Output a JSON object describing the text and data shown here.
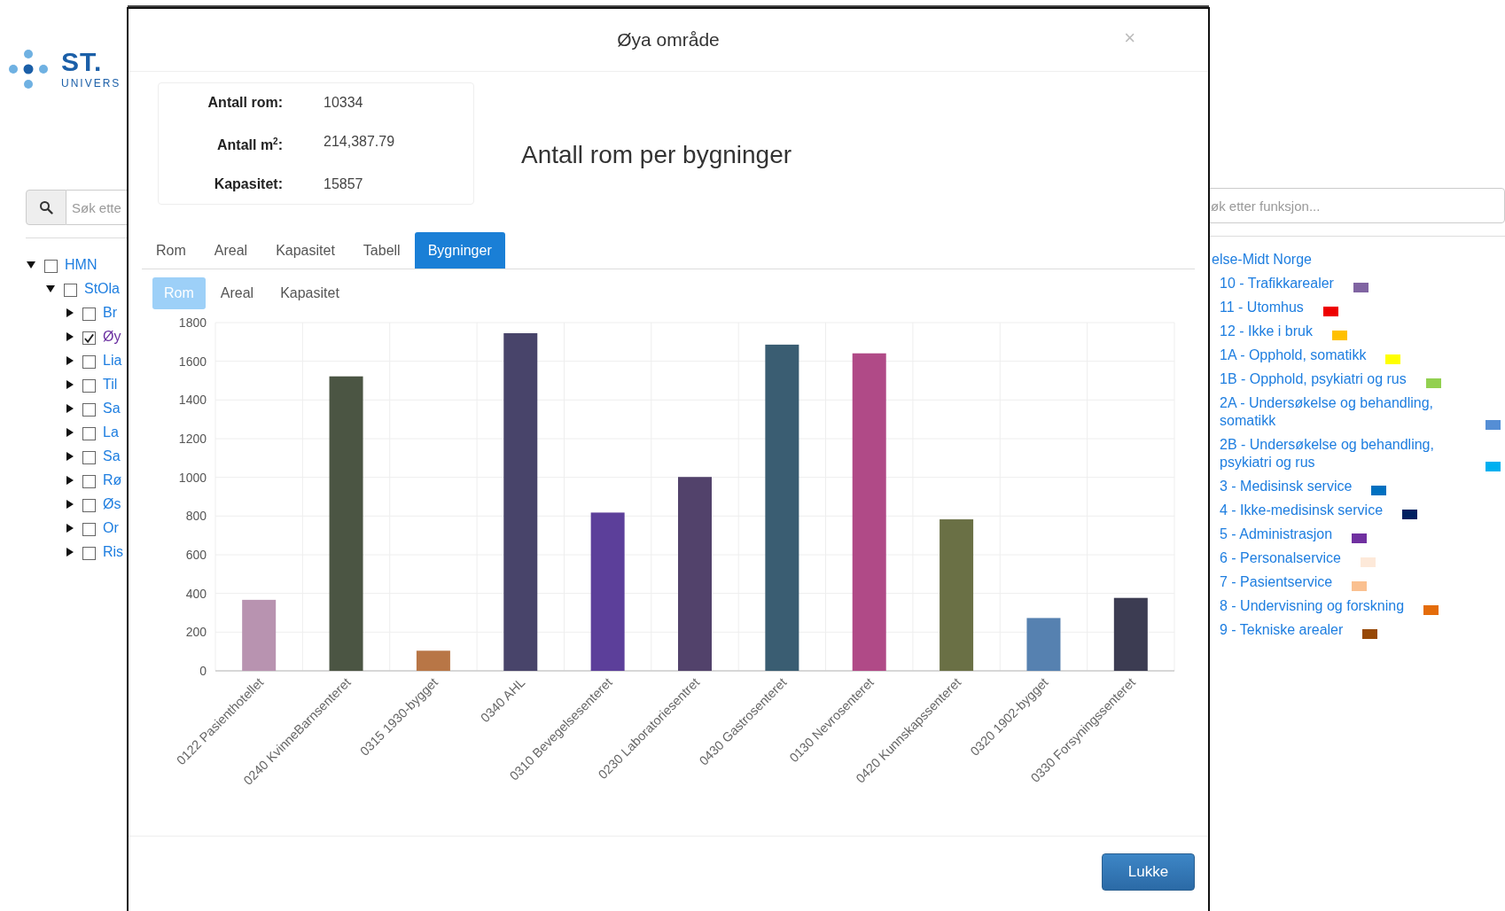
{
  "logo": {
    "title": "ST.",
    "subtitle": "UNIVERS"
  },
  "left_search": {
    "placeholder": "Søk ette"
  },
  "tree": [
    {
      "label": "HMN",
      "expanded": true,
      "checked": false,
      "selected": false,
      "children": [
        {
          "label": "StOla",
          "expanded": true,
          "checked": false,
          "selected": false,
          "children": [
            {
              "label": "Br",
              "expanded": false,
              "checked": false,
              "selected": false
            },
            {
              "label": "Øy",
              "expanded": false,
              "checked": true,
              "selected": true
            },
            {
              "label": "Lia",
              "expanded": false,
              "checked": false,
              "selected": false
            },
            {
              "label": "Til",
              "expanded": false,
              "checked": false,
              "selected": false
            },
            {
              "label": "Sa",
              "expanded": false,
              "checked": false,
              "selected": false
            },
            {
              "label": "La",
              "expanded": false,
              "checked": false,
              "selected": false
            },
            {
              "label": "Sa",
              "expanded": false,
              "checked": false,
              "selected": false
            },
            {
              "label": "Rø",
              "expanded": false,
              "checked": false,
              "selected": false
            },
            {
              "label": "Øs",
              "expanded": false,
              "checked": false,
              "selected": false
            },
            {
              "label": "Or",
              "expanded": false,
              "checked": false,
              "selected": false
            },
            {
              "label": "Ris",
              "expanded": false,
              "checked": false,
              "selected": false
            }
          ]
        }
      ]
    }
  ],
  "right_search": {
    "placeholder": "øk etter funksjon..."
  },
  "legend": {
    "title": "else-Midt Norge",
    "items": [
      {
        "label": "10 - Trafikkarealer",
        "color": "#8064a2"
      },
      {
        "label": "11 - Utomhus",
        "color": "#ee0000"
      },
      {
        "label": "12 - Ikke i bruk",
        "color": "#ffc000"
      },
      {
        "label": "1A - Opphold, somatikk",
        "color": "#ffff00"
      },
      {
        "label": "1B - Opphold, psykiatri og rus",
        "color": "#92d050"
      },
      {
        "label": "2A - Undersøkelse og behandling, somatikk",
        "color": "#558ed5"
      },
      {
        "label": "2B - Undersøkelse og behandling, psykiatri og rus",
        "color": "#00b0f0"
      },
      {
        "label": "3 - Medisinsk service",
        "color": "#0070c0"
      },
      {
        "label": "4 - Ikke-medisinsk service",
        "color": "#002060"
      },
      {
        "label": "5 - Administrasjon",
        "color": "#7030a0"
      },
      {
        "label": "6 - Personalservice",
        "color": "#fde9d9"
      },
      {
        "label": "7 - Pasientservice",
        "color": "#fac090"
      },
      {
        "label": "8 - Undervisning og forskning",
        "color": "#e46c0a"
      },
      {
        "label": "9 - Tekniske arealer",
        "color": "#974806"
      }
    ]
  },
  "modal": {
    "title": "Øya område",
    "close": "×",
    "stats": [
      {
        "label": "Antall rom:",
        "value": "10334"
      },
      {
        "label": "Antall m$^{2}$:",
        "value": "214,387.79"
      },
      {
        "label": "Kapasitet:",
        "value": "15857"
      }
    ],
    "heading": "Antall rom per bygninger",
    "tabs": [
      {
        "label": "Rom",
        "selected": false
      },
      {
        "label": "Areal",
        "selected": false
      },
      {
        "label": "Kapasitet",
        "selected": false
      },
      {
        "label": "Tabell",
        "selected": false
      },
      {
        "label": "Bygninger",
        "selected": true
      }
    ],
    "subtabs": [
      {
        "label": "Rom",
        "selected": true
      },
      {
        "label": "Areal",
        "selected": false
      },
      {
        "label": "Kapasitet",
        "selected": false
      }
    ],
    "chart_data": {
      "type": "bar",
      "categories": [
        "0122 Pasienthotellet",
        "0240 KvinneBarnsenteret",
        "0315 1930-bygget",
        "0340 AHL",
        "0310 Bevegelsesenteret",
        "0230 Laboratoriesentret",
        "0430 Gastrosenteret",
        "0130 Nevrosenteret",
        "0420 Kunnskapssenteret",
        "0320 1902-bygget",
        "0330 Forsyningssenteret"
      ],
      "grid": true,
      "series": [
        {
          "values": [
            367,
            1522,
            104,
            1745,
            818,
            1002,
            1686,
            1641,
            783,
            273,
            377
          ],
          "colors": [
            "#b893b0",
            "#4b5543",
            "#b87646",
            "#48446a",
            "#5c3f9a",
            "#52426b",
            "#3a5d72",
            "#b04a87",
            "#6a7045",
            "#5681b0",
            "#3c3c52"
          ]
        }
      ],
      "ylim": [
        0,
        1800
      ],
      "yticks": [
        0,
        200,
        400,
        600,
        800,
        1000,
        1200,
        1400,
        1600,
        1800
      ]
    },
    "close_button": "Lukke"
  }
}
